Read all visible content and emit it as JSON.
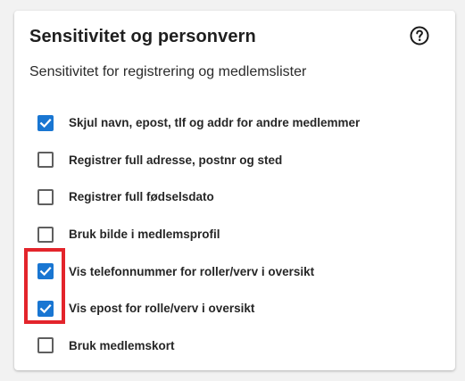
{
  "card": {
    "title": "Sensitivitet og personvern",
    "help_icon": "help-circle-icon",
    "subtitle": "Sensitivitet for registrering og medlemslister"
  },
  "options": [
    {
      "label": "Skjul navn, epost, tlf og addr for andre medlemmer",
      "checked": true
    },
    {
      "label": "Registrer full adresse, postnr og sted",
      "checked": false
    },
    {
      "label": "Registrer full fødselsdato",
      "checked": false
    },
    {
      "label": "Bruk bilde i medlemsprofil",
      "checked": false
    },
    {
      "label": "Vis telefonnummer for roller/verv i oversikt",
      "checked": true
    },
    {
      "label": "Vis epost for rolle/verv i oversikt",
      "checked": true
    },
    {
      "label": "Bruk medlemskort",
      "checked": false
    }
  ],
  "colors": {
    "checkbox_checked": "#1976d2",
    "checkbox_border": "#5f5f5f",
    "highlight": "#e3242b"
  }
}
